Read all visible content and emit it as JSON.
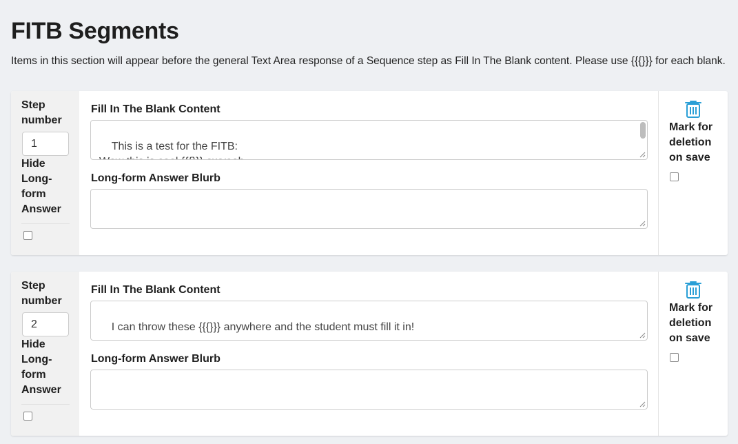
{
  "page": {
    "title": "FITB Segments",
    "description": "Items in this section will appear before the general Text Area response of a Sequence step as Fill In The Blank content. Please use {{{}}} for each blank."
  },
  "labels": {
    "step_number_line1": "Step",
    "step_number_line2": "number",
    "hide_line1": "Hide",
    "hide_line2": "Long-",
    "hide_line3": "form",
    "hide_line4": "Answer",
    "fitb_content": "Fill In The Blank Content",
    "long_form_blurb": "Long-form Answer Blurb",
    "mark_line1": "Mark for",
    "mark_line2": "deletion",
    "mark_line3": "on save"
  },
  "segments": [
    {
      "step_number": "1",
      "fitb_content": "This is a test for the FITB:\nWow this is cool {{{}}} awyeah,\nI can throw more in and see this is a blank {{{}}}",
      "long_form_blurb": "",
      "hide_long_form": false,
      "mark_for_deletion": false
    },
    {
      "step_number": "2",
      "fitb_content": "I can throw these {{{}}} anywhere and the student must fill it in!",
      "long_form_blurb": "",
      "hide_long_form": false,
      "mark_for_deletion": false
    }
  ],
  "icons": {
    "trash": "trash-icon"
  },
  "colors": {
    "accent": "#2a9fd6",
    "background": "#eef0f3",
    "left_panel": "#f1f1f1"
  }
}
